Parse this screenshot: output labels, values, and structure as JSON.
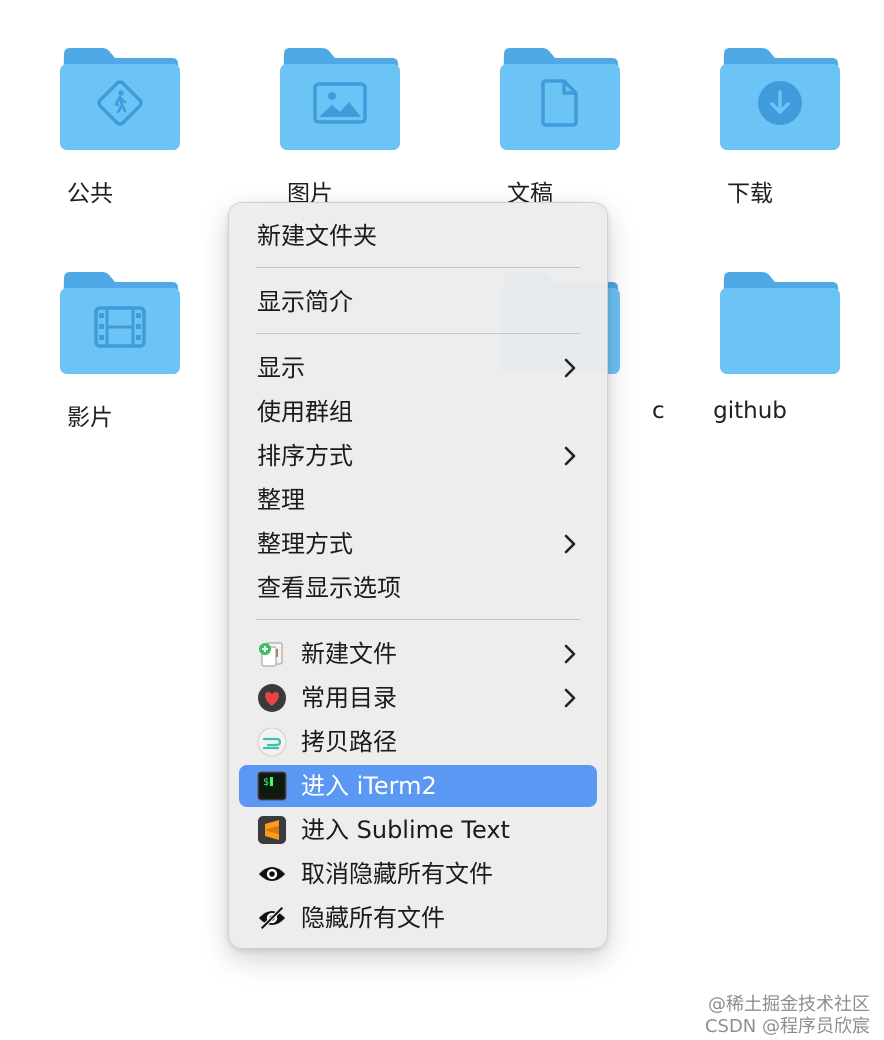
{
  "folders": [
    {
      "label": "公共",
      "icon": "public-walker-icon"
    },
    {
      "label": "图片",
      "icon": "photo-icon"
    },
    {
      "label": "文稿",
      "icon": "document-icon"
    },
    {
      "label": "下载",
      "icon": "download-icon"
    },
    {
      "label": "影片",
      "icon": "film-icon"
    },
    {
      "label": "c",
      "icon": ""
    },
    {
      "label": "github",
      "icon": ""
    }
  ],
  "menu": {
    "items": [
      {
        "label": "新建文件夹"
      },
      {
        "label": "显示简介"
      },
      {
        "label": "显示",
        "submenu": true
      },
      {
        "label": "使用群组"
      },
      {
        "label": "排序方式",
        "submenu": true
      },
      {
        "label": "整理"
      },
      {
        "label": "整理方式",
        "submenu": true
      },
      {
        "label": "查看显示选项"
      },
      {
        "label": "新建文件",
        "submenu": true,
        "icon": "new-file-icon"
      },
      {
        "label": "常用目录",
        "submenu": true,
        "icon": "heart-icon"
      },
      {
        "label": "拷贝路径",
        "icon": "copy-path-icon"
      },
      {
        "label": "进入 iTerm2",
        "icon": "iterm2-icon",
        "highlighted": true
      },
      {
        "label": "进入 Sublime Text",
        "icon": "sublime-text-icon"
      },
      {
        "label": "取消隐藏所有文件",
        "icon": "eye-icon"
      },
      {
        "label": "隐藏所有文件",
        "icon": "eye-slash-icon"
      }
    ]
  },
  "watermark": {
    "line1": "@稀土掘金技术社区",
    "line2": "CSDN @程序员欣宸"
  },
  "colors": {
    "folder_body": "#6cc3f5",
    "folder_tab": "#4ea9e6",
    "folder_glyph": "#3f9bd9",
    "menu_highlight": "#5a98f3"
  }
}
